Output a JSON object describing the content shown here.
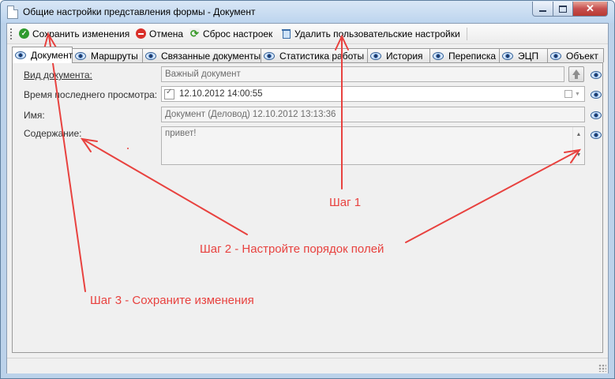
{
  "window": {
    "title": "Общие настройки представления формы - Документ"
  },
  "toolbar": {
    "save_label": "Сохранить изменения",
    "cancel_label": "Отмена",
    "reset_label": "Сброс настроек",
    "delete_label": "Удалить пользовательские настройки"
  },
  "tabs": [
    {
      "label": "Документ"
    },
    {
      "label": "Маршруты"
    },
    {
      "label": "Связанные документы"
    },
    {
      "label": "Статистика работы"
    },
    {
      "label": "История"
    },
    {
      "label": "Переписка"
    },
    {
      "label": "ЭЦП"
    },
    {
      "label": "Объект"
    }
  ],
  "form": {
    "doc_type_label": "Вид документа:",
    "doc_type_value": "Важный документ",
    "last_view_label": "Время последнего просмотра:",
    "last_view_value": "12.10.2012 14:00:55",
    "name_label": "Имя:",
    "name_value": "Документ (Деловод) 12.10.2012 13:13:36",
    "content_label": "Содержание:",
    "content_value": "привет!"
  },
  "annotations": {
    "step1": "Шаг 1",
    "step2": "Шаг 2 - Настройте порядок полей",
    "step3": "Шаг 3 - Сохраните изменения"
  },
  "colors": {
    "annotation": "#e8423f",
    "titlebar": "#bcd4ee"
  }
}
